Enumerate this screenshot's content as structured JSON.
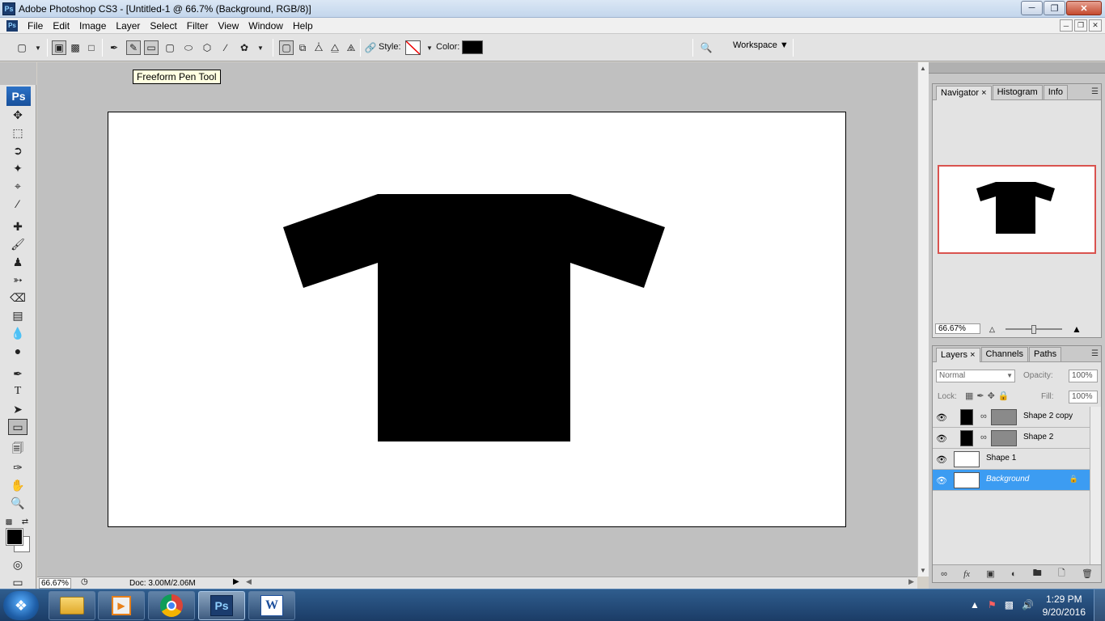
{
  "window": {
    "title": "Adobe Photoshop CS3 - [Untitled-1 @ 66.7% (Background, RGB/8)]"
  },
  "menu": [
    "File",
    "Edit",
    "Image",
    "Layer",
    "Select",
    "Filter",
    "View",
    "Window",
    "Help"
  ],
  "options": {
    "style_label": "Style:",
    "color_label": "Color:",
    "workspace_label": "Workspace",
    "shape_color": "#000000"
  },
  "tooltip": "Freeform Pen Tool",
  "toolbox": {
    "logo": "Ps",
    "selected_tool": "rectangle-tool"
  },
  "status": {
    "zoom": "66.67%",
    "doc": "Doc: 3.00M/2.06M"
  },
  "navigator": {
    "tabs": [
      "Navigator",
      "Histogram",
      "Info"
    ],
    "zoom": "66.67%"
  },
  "layers": {
    "tabs": [
      "Layers",
      "Channels",
      "Paths"
    ],
    "blend_mode": "Normal",
    "opacity_label": "Opacity:",
    "opacity": "100%",
    "lock_label": "Lock:",
    "fill_label": "Fill:",
    "fill": "100%",
    "items": [
      {
        "name": "Shape 2 copy"
      },
      {
        "name": "Shape 2"
      },
      {
        "name": "Shape 1"
      },
      {
        "name": "Background"
      }
    ]
  },
  "taskbar": {
    "time": "1:29 PM",
    "date": "9/20/2016",
    "ps_label": "Ps"
  },
  "colors": {
    "accent": "#3c9cf2",
    "canvas_bg": "#c0c0c0",
    "navigator_frame": "#d9534f"
  }
}
